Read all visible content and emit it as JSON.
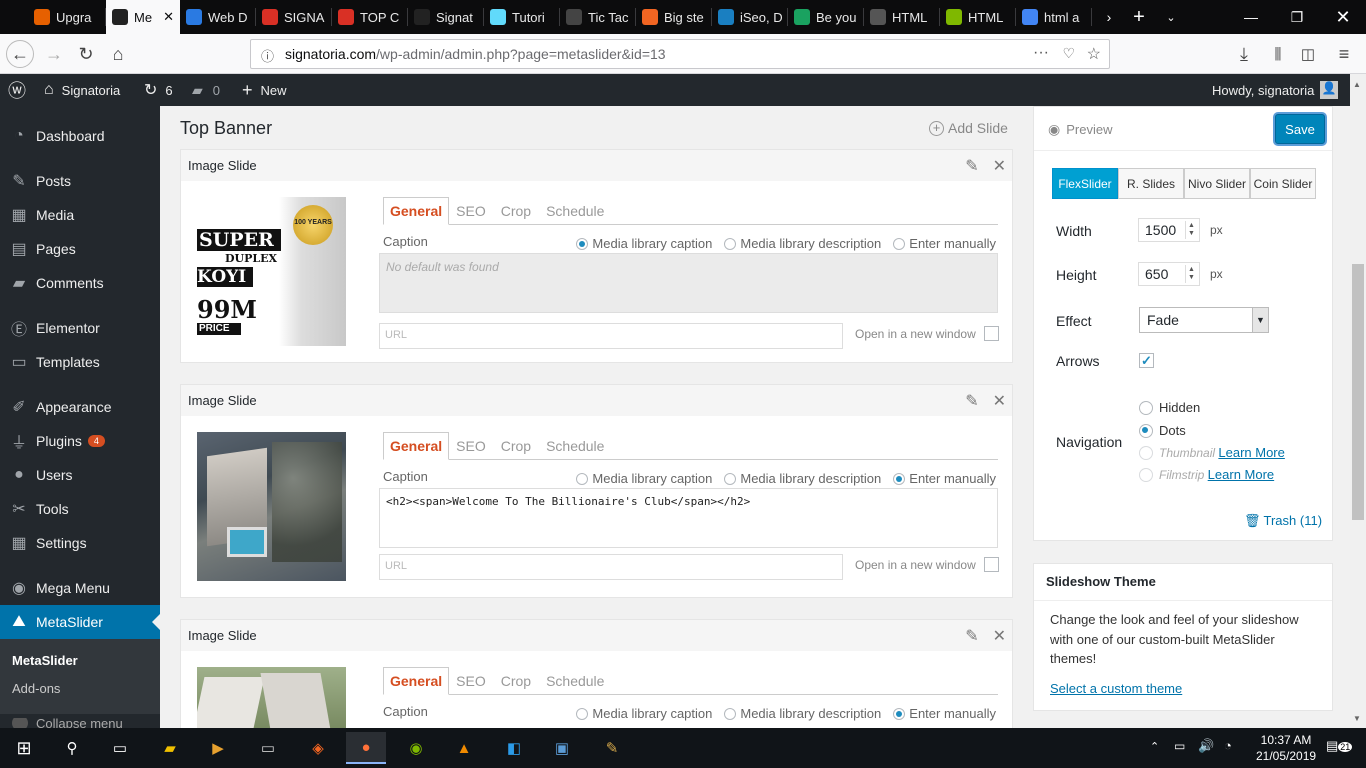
{
  "browser": {
    "tabs": [
      {
        "label": "Upgra",
        "icon_color": "#e66000"
      },
      {
        "label": "Me",
        "icon_color": "#222222",
        "active": true
      },
      {
        "label": "Web D",
        "icon_color": "#2a7ae2"
      },
      {
        "label": "SIGNA",
        "icon_color": "#d93025"
      },
      {
        "label": "TOP C",
        "icon_color": "#d93025"
      },
      {
        "label": "Signat",
        "icon_color": "#222222"
      },
      {
        "label": "Tutori",
        "icon_color": "#61dafb"
      },
      {
        "label": "Tic Tac",
        "icon_color": "#444444"
      },
      {
        "label": "Big ste",
        "icon_color": "#f26522"
      },
      {
        "label": "iSeo, D",
        "icon_color": "#1a7fc1"
      },
      {
        "label": "Be you",
        "icon_color": "#1aa260"
      },
      {
        "label": "HTML",
        "icon_color": "#555555"
      },
      {
        "label": "HTML",
        "icon_color": "#7fb800"
      },
      {
        "label": "html a",
        "icon_color": "#4285f4"
      }
    ],
    "url_domain": "signatoria.com",
    "url_path": "/wp-admin/admin.php?page=metaslider&id=13"
  },
  "adminbar": {
    "site_name": "Signatoria",
    "updates_count": "6",
    "comments_count": "0",
    "new_label": "New",
    "howdy": "Howdy, signatoria"
  },
  "sidebar": {
    "items": [
      {
        "label": "Dashboard",
        "icon": "dashboard-icon"
      },
      {
        "label": "Posts",
        "icon": "pin-icon"
      },
      {
        "label": "Media",
        "icon": "media-icon"
      },
      {
        "label": "Pages",
        "icon": "pages-icon"
      },
      {
        "label": "Comments",
        "icon": "comment-icon"
      },
      {
        "label": "Elementor",
        "icon": "elementor-icon"
      },
      {
        "label": "Templates",
        "icon": "folder-icon"
      },
      {
        "label": "Appearance",
        "icon": "brush-icon"
      },
      {
        "label": "Plugins",
        "icon": "plug-icon",
        "badge": "4"
      },
      {
        "label": "Users",
        "icon": "user-icon"
      },
      {
        "label": "Tools",
        "icon": "wrench-icon"
      },
      {
        "label": "Settings",
        "icon": "settings-icon"
      },
      {
        "label": "Mega Menu",
        "icon": "menu-icon"
      },
      {
        "label": "MetaSlider",
        "icon": "metaslider-icon",
        "current": true
      }
    ],
    "submenu": [
      "MetaSlider",
      "Add-ons"
    ],
    "collapse_label": "Collapse menu"
  },
  "main": {
    "title": "Top Banner",
    "add_slide_label": "Add Slide",
    "slides": [
      {
        "header": "Image Slide",
        "tabs": [
          "General",
          "SEO",
          "Crop",
          "Schedule"
        ],
        "caption_label": "Caption",
        "caption_options": [
          "Media library caption",
          "Media library description",
          "Enter manually"
        ],
        "caption_selected": 0,
        "caption_text": "No default was found",
        "url_placeholder": "URL",
        "new_window_label": "Open in a new window",
        "thumb_lines": [
          "SUPER",
          "DUPLEX",
          "KOYI",
          "99M",
          "PRICE"
        ],
        "thumb_seal": "100 YEARS"
      },
      {
        "header": "Image Slide",
        "tabs": [
          "General",
          "SEO",
          "Crop",
          "Schedule"
        ],
        "caption_label": "Caption",
        "caption_options": [
          "Media library caption",
          "Media library description",
          "Enter manually"
        ],
        "caption_selected": 2,
        "caption_text": "<h2><span>Welcome To The Billionaire's Club</span></h2>",
        "url_placeholder": "URL",
        "new_window_label": "Open in a new window"
      },
      {
        "header": "Image Slide",
        "tabs": [
          "General",
          "SEO",
          "Crop",
          "Schedule"
        ],
        "caption_label": "Caption",
        "caption_options": [
          "Media library caption",
          "Media library description",
          "Enter manually"
        ],
        "caption_selected": 2
      }
    ]
  },
  "settings": {
    "preview_label": "Preview",
    "save_label": "Save",
    "libraries": [
      "FlexSlider",
      "R. Slides",
      "Nivo Slider",
      "Coin Slider"
    ],
    "library_selected": "FlexSlider",
    "width_label": "Width",
    "width_value": "1500",
    "height_label": "Height",
    "height_value": "650",
    "unit": "px",
    "effect_label": "Effect",
    "effect_value": "Fade",
    "arrows_label": "Arrows",
    "arrows_checked": true,
    "navigation_label": "Navigation",
    "navigation_options": [
      "Hidden",
      "Dots",
      "Thumbnail",
      "Filmstrip"
    ],
    "navigation_selected": "Dots",
    "learn_more": "Learn More",
    "trash_label": "Trash (11)"
  },
  "theme_panel": {
    "title": "Slideshow Theme",
    "description": "Change the look and feel of your slideshow with one of our custom-built MetaSlider themes!",
    "link": "Select a custom theme"
  },
  "taskbar": {
    "time": "10:37 AM",
    "date": "21/05/2019",
    "notifications": "21"
  },
  "colors": {
    "wp_dark": "#23282d",
    "wp_blue": "#0073aa",
    "flex_blue": "#00a0d2",
    "orange_tab": "#d54e21"
  }
}
